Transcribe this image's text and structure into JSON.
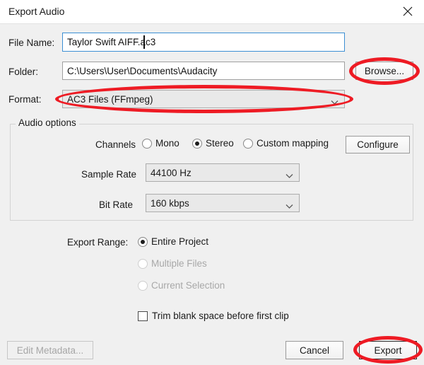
{
  "window": {
    "title": "Export Audio",
    "close_icon": "close-icon"
  },
  "colors": {
    "annotation_red": "#ee1b24",
    "focus_blue": "#3c8fd4",
    "dialog_bg": "#f0f0f0",
    "titlebar_bg": "#ffffff"
  },
  "fields": {
    "file_name": {
      "label": "File Name:",
      "value": "Taylor Swift AIFF.ac3",
      "placeholder": "Enter file name"
    },
    "folder": {
      "label": "Folder:",
      "value": "C:\\Users\\User\\Documents\\Audacity",
      "placeholder": "Choose a folder",
      "browse_label": "Browse..."
    },
    "format": {
      "label": "Format:",
      "value": "AC3 Files (FFmpeg)",
      "chevron_icon": "chevron-down-icon"
    }
  },
  "audio_options": {
    "group_title": "Audio options",
    "channels": {
      "label": "Channels",
      "options": [
        {
          "label": "Mono",
          "selected": false,
          "disabled": false
        },
        {
          "label": "Stereo",
          "selected": true,
          "disabled": false
        },
        {
          "label": "Custom mapping",
          "selected": false,
          "disabled": false
        }
      ],
      "configure_label": "Configure"
    },
    "sample_rate": {
      "label": "Sample Rate",
      "value": "44100 Hz",
      "chevron_icon": "chevron-down-icon"
    },
    "bit_rate": {
      "label": "Bit Rate",
      "value": "160 kbps",
      "chevron_icon": "chevron-down-icon"
    }
  },
  "export_range": {
    "label": "Export Range:",
    "options": [
      {
        "label": "Entire Project",
        "selected": true,
        "disabled": false
      },
      {
        "label": "Multiple Files",
        "selected": false,
        "disabled": true
      },
      {
        "label": "Current Selection",
        "selected": false,
        "disabled": true
      }
    ]
  },
  "trim_option": {
    "label": "Trim blank space before first clip",
    "checked": false
  },
  "footer": {
    "edit_metadata_label": "Edit Metadata...",
    "cancel_label": "Cancel",
    "export_label": "Export"
  }
}
